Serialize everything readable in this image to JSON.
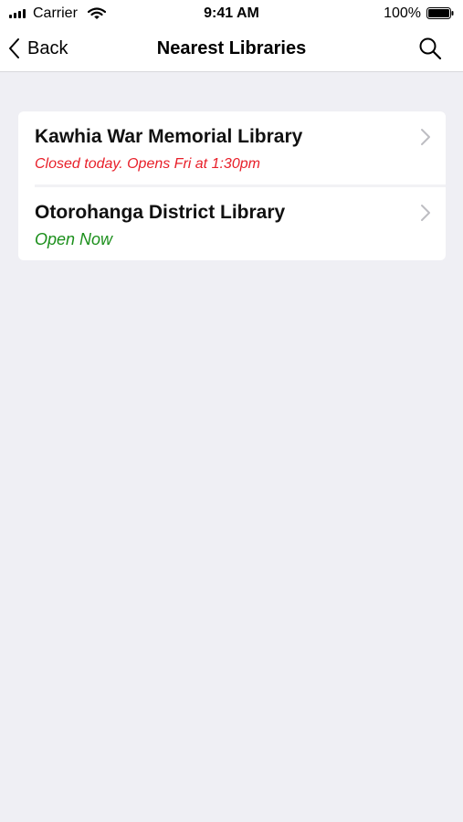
{
  "status_bar": {
    "carrier": "Carrier",
    "time": "9:41 AM",
    "battery_percent": "100%",
    "signal_bars": 4,
    "battery_level": 1.0,
    "icons": [
      "signal-icon",
      "wifi-icon",
      "battery-icon"
    ]
  },
  "nav": {
    "back_label": "Back",
    "title": "Nearest Libraries",
    "icons": [
      "back-chevron-icon",
      "search-icon"
    ]
  },
  "libraries": [
    {
      "name": "Kawhia War Memorial Library",
      "status": "Closed today. Opens Fri at 1:30pm",
      "status_color": "#e8202a",
      "icon": "chevron-right-icon"
    },
    {
      "name": "Otorohanga District Library",
      "status": "Open Now",
      "status_color": "#1b8f1b",
      "icon": "chevron-right-icon"
    }
  ],
  "colors": {
    "background": "#efeff4",
    "card": "#ffffff",
    "closed": "#e8202a",
    "open": "#1b8f1b"
  }
}
